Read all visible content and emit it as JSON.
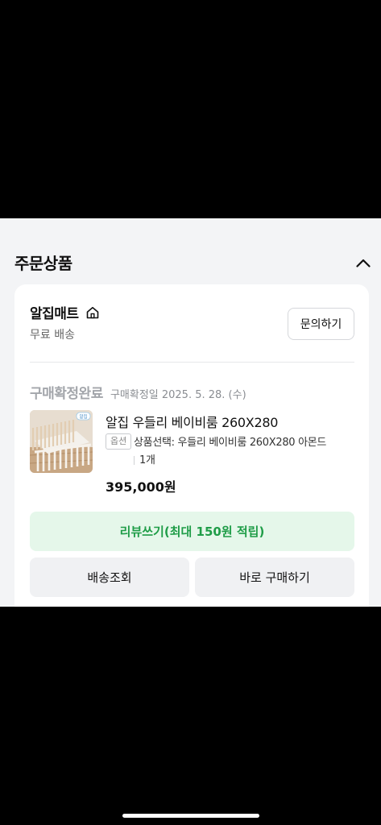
{
  "section": {
    "title": "주문상품"
  },
  "seller": {
    "name": "알집매트",
    "shipping": "무료 배송",
    "inquiry_label": "문의하기"
  },
  "order": {
    "status": "구매확정완료",
    "confirm_date": "구매확정일 2025. 5. 28. (수)",
    "product_name": "알집 우들리 베이비룸 260X280",
    "option_badge": "옵션",
    "option_text": "상품선택: 우들리 베이비룸 260X280 아몬드",
    "quantity": "1개",
    "price": "395,000원",
    "thumb_badge": "알집"
  },
  "actions": {
    "review_label": "리뷰쓰기(최대 150원 적립)",
    "tracking_label": "배송조회",
    "buy_again_label": "바로 구매하기"
  },
  "colors": {
    "review_green": "#1f9d48",
    "review_bg": "#e5f7ea",
    "panel_bg": "#f3f4f6"
  }
}
